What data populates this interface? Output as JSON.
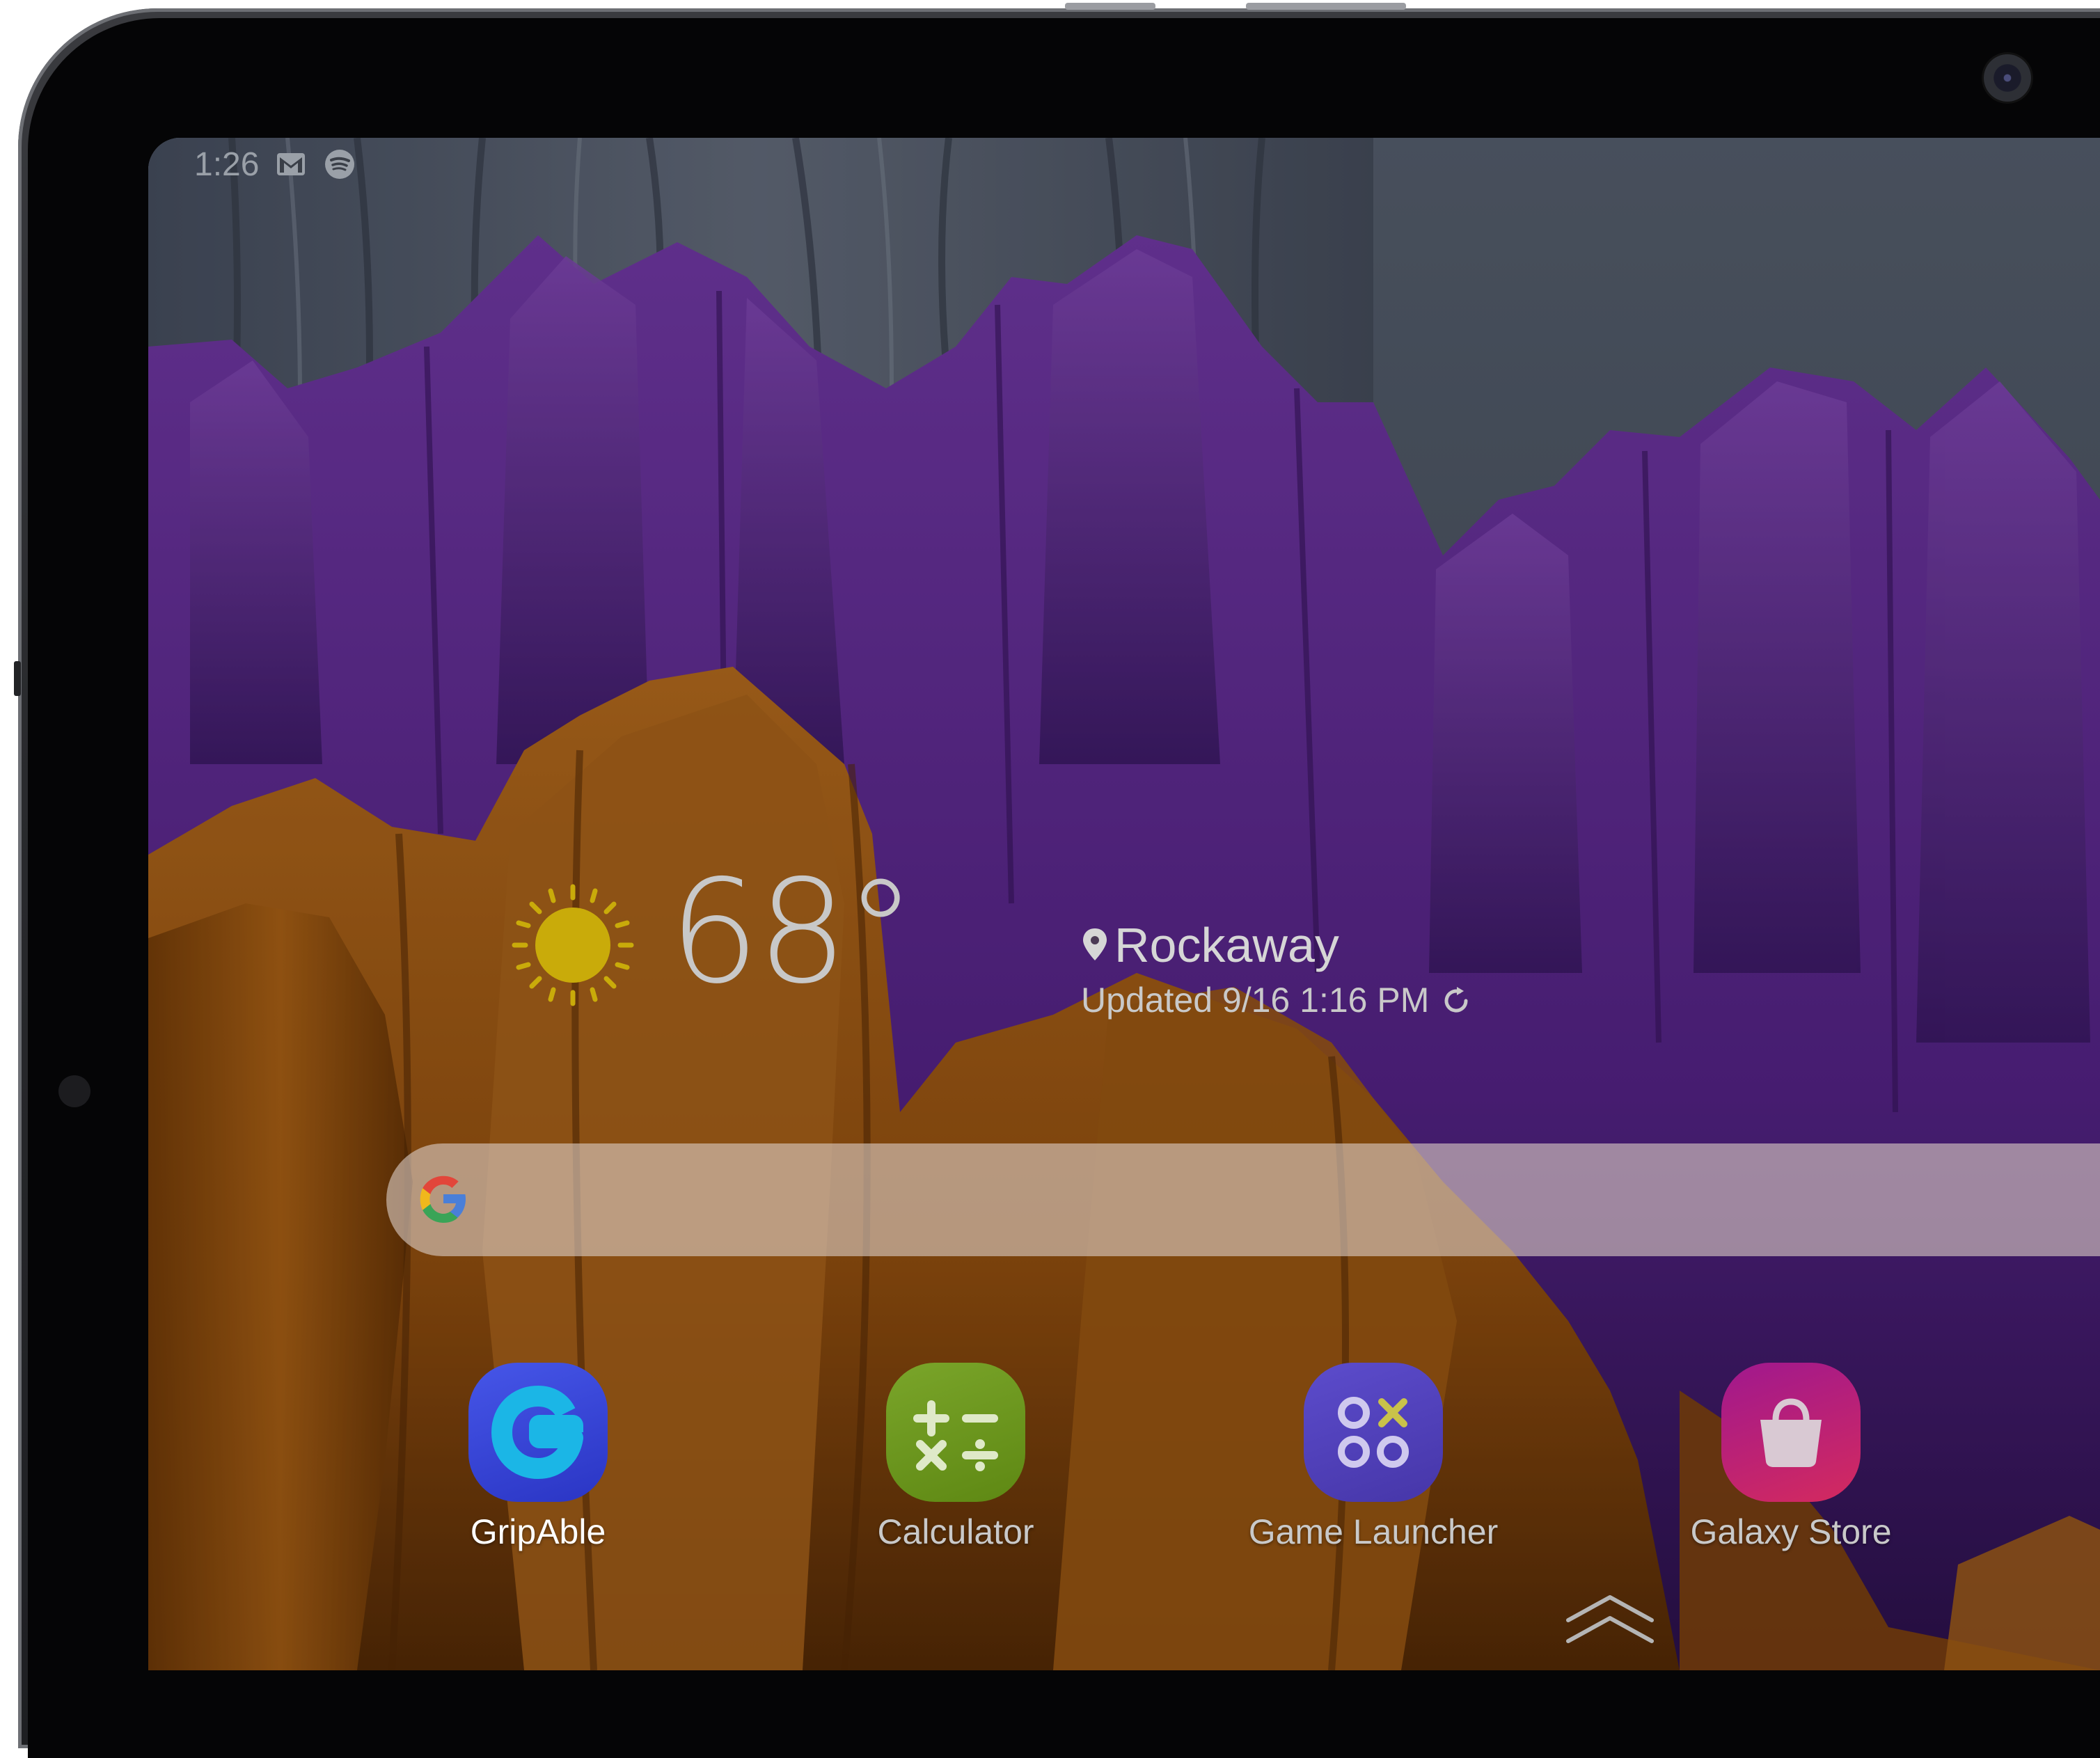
{
  "status_bar": {
    "time": "1:26",
    "icons": [
      "gmail-icon",
      "spotify-icon"
    ]
  },
  "weather": {
    "icon": "sun-icon",
    "temperature": "68°",
    "location": "Rockaway",
    "updated": "Updated 9/16 1:16 PM",
    "refresh_icon": "refresh-icon"
  },
  "search": {
    "icon": "google-icon",
    "placeholder": ""
  },
  "apps": [
    {
      "label": "GripAble",
      "icon": "gripable-icon",
      "color": "#2f46d8"
    },
    {
      "label": "Calculator",
      "icon": "calculator-icon",
      "color": "#6e9a1c"
    },
    {
      "label": "Game Launcher",
      "icon": "game-launcher-icon",
      "color": "#5a46c4"
    },
    {
      "label": "Galaxy Store",
      "icon": "galaxy-store-icon",
      "color": "#c0247a"
    }
  ],
  "app_drawer": {
    "icon": "chevron-up-icon"
  },
  "colors": {
    "accent_purple": "#6b2fa0",
    "accent_orange": "#b5651d",
    "sun_yellow": "#d7b80a"
  }
}
